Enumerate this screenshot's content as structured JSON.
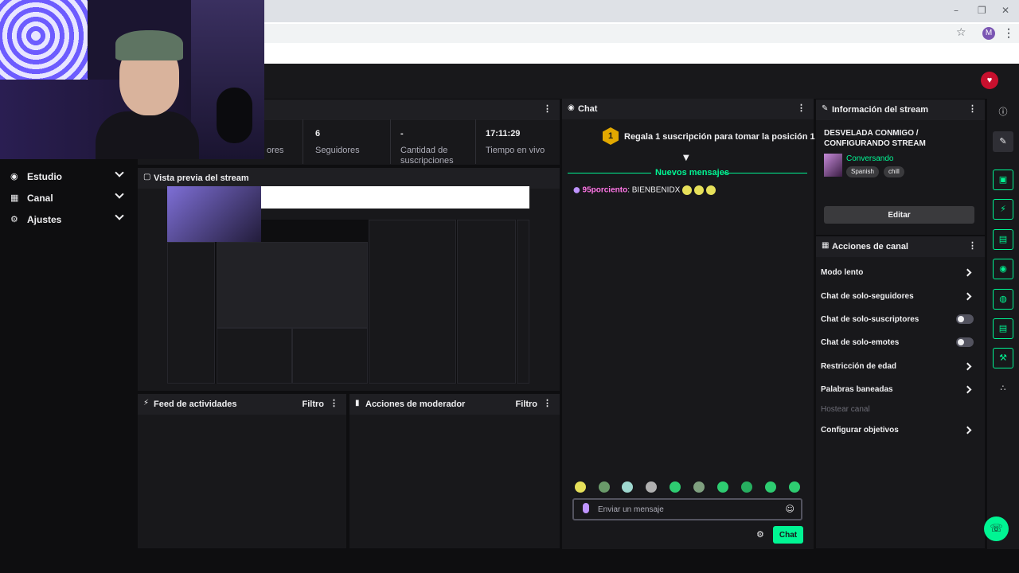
{
  "nav": {
    "items": [
      {
        "label": "Estudio",
        "icon": "studio-icon"
      },
      {
        "label": "Canal",
        "icon": "channel-icon"
      },
      {
        "label": "Ajustes",
        "icon": "settings-gear-icon"
      }
    ]
  },
  "stats": [
    {
      "value": "",
      "label": "ores"
    },
    {
      "value": "6",
      "label": "Seguidores"
    },
    {
      "value": "-",
      "label": "Cantidad de suscripciones"
    },
    {
      "value": "17:11:29",
      "label": "Tiempo en vivo"
    }
  ],
  "preview": {
    "title": "Vista previa del stream"
  },
  "activity_feed": {
    "title": "Feed de actividades",
    "filter": "Filtro"
  },
  "mod_actions": {
    "title": "Acciones de moderador",
    "filter": "Filtro"
  },
  "chat": {
    "title": "Chat",
    "gift_badge": "1",
    "gift_text": "Regala 1 suscripción para tomar la posición 1",
    "new_messages": "Nuevos mensajes",
    "messages": [
      {
        "user": "95porciento",
        "separator": ":",
        "text": "BIENBENIDX"
      }
    ],
    "input_placeholder": "Enviar un mensaje",
    "send_label": "Chat",
    "colors": {
      "accent": "#00f593",
      "username": "#ff75e6"
    }
  },
  "stream_info": {
    "title": "Información del stream",
    "stream_title": "DESVELADA CONMIGO / CONFIGURANDO STREAM",
    "category": "Conversando",
    "tags": [
      "Spanish",
      "chill"
    ],
    "edit_label": "Editar"
  },
  "channel_actions": {
    "title": "Acciones de canal",
    "items": [
      {
        "label": "Modo lento",
        "control": "arrow"
      },
      {
        "label": "Chat de solo-seguidores",
        "control": "arrow"
      },
      {
        "label": "Chat de solo-suscriptores",
        "control": "toggle"
      },
      {
        "label": "Chat de solo-emotes",
        "control": "toggle"
      },
      {
        "label": "Restricción de edad",
        "control": "arrow"
      },
      {
        "label": "Palabras baneadas",
        "control": "arrow"
      },
      {
        "label": "Hostear canal",
        "control": "disabled"
      },
      {
        "label": "Configurar objetivos",
        "control": "arrow"
      }
    ]
  },
  "browser": {
    "profile_initial": "M"
  },
  "brand_logo_text": "♥"
}
